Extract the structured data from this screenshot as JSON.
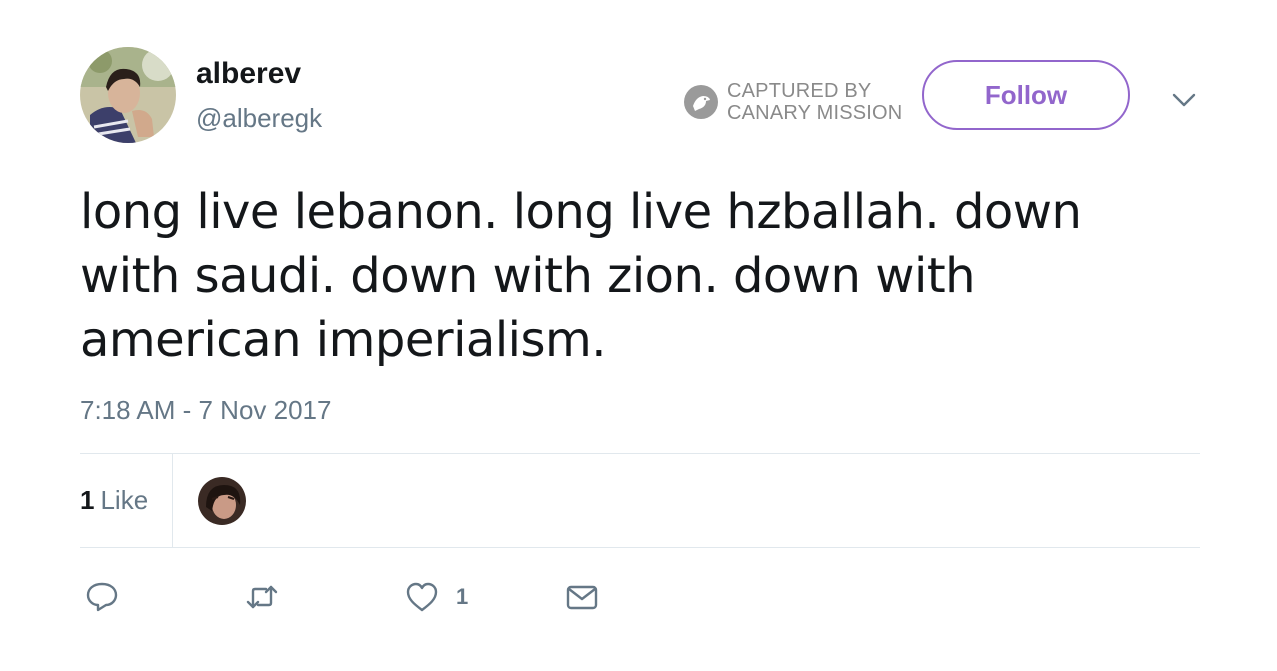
{
  "user": {
    "display_name": "alberev",
    "handle": "@alberegk"
  },
  "watermark": {
    "line1": "CAPTURED BY",
    "line2": "CANARY MISSION"
  },
  "follow_label": "Follow",
  "tweet": {
    "text": "long live lebanon. long live hzballah. down with saudi. down with zion. down with american imperialism.",
    "timestamp": "7:18 AM - 7 Nov 2017"
  },
  "stats": {
    "likes_count": "1",
    "likes_label": "Like"
  },
  "actions": {
    "like_count": "1"
  },
  "icons": {
    "reply": "reply-icon",
    "retweet": "retweet-icon",
    "like": "heart-icon",
    "dm": "envelope-icon",
    "more": "chevron-down-icon",
    "watermark": "canary-bird-icon"
  },
  "colors": {
    "accent": "#9266cc",
    "secondary_text": "#657786",
    "primary_text": "#14171a",
    "divider": "#e1e8ed"
  }
}
